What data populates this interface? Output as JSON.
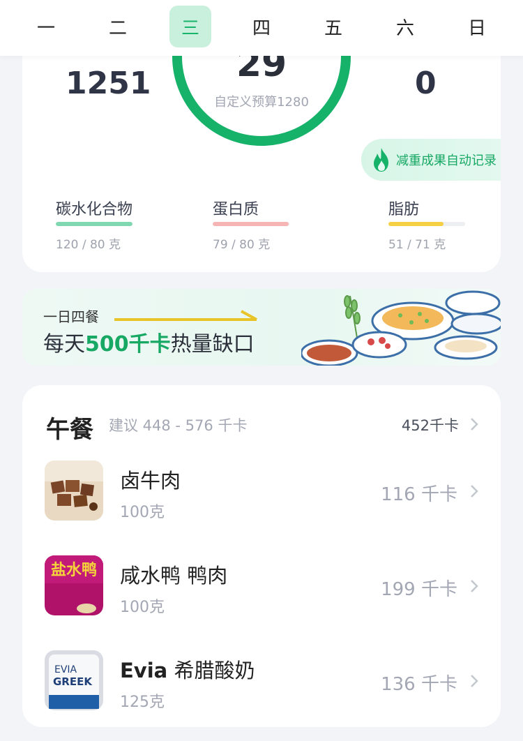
{
  "week": {
    "days": [
      "一",
      "二",
      "三",
      "四",
      "五",
      "六",
      "日"
    ],
    "selected_index": 2
  },
  "summary": {
    "intake_value": "1251",
    "ring_value": "29",
    "ring_subtitle": "自定义预算1280",
    "exercise_value": "0",
    "weight_record_label": "减重成果自动记录",
    "macros": [
      {
        "name": "碳水化合物",
        "value": "120 / 80 克",
        "fill_fraction": 1.0,
        "color": "#7fd8b0"
      },
      {
        "name": "蛋白质",
        "value": "79 / 80 克",
        "fill_fraction": 0.99,
        "color": "#f6b4b4"
      },
      {
        "name": "脂肪",
        "value": "51 / 71 克",
        "fill_fraction": 0.72,
        "color": "#f5cf44"
      }
    ]
  },
  "banner": {
    "small_text": "一日四餐",
    "big_prefix": "每天",
    "big_highlight": "500千卡",
    "big_suffix": "热量缺口"
  },
  "lunch": {
    "title": "午餐",
    "suggestion": "建议 448 - 576 千卡",
    "total": "452千卡",
    "items": [
      {
        "name_bold": "",
        "name": "卤牛肉",
        "weight": "100克",
        "kcal": "116 千卡"
      },
      {
        "name_bold": "",
        "name": "咸水鸭 鸭肉",
        "weight": "100克",
        "kcal": "199 千卡"
      },
      {
        "name_bold": "Evia",
        "name": " 希腊酸奶",
        "weight": "125克",
        "kcal": "136 千卡"
      }
    ]
  },
  "thumb_text": {
    "duck_package": "盐水鸭",
    "yogurt_brand": "EVIA",
    "yogurt_type": "GREEK"
  },
  "colors": {
    "accent": "#17b26a",
    "ring": "#17b26a",
    "background": "#f3f4f8"
  }
}
